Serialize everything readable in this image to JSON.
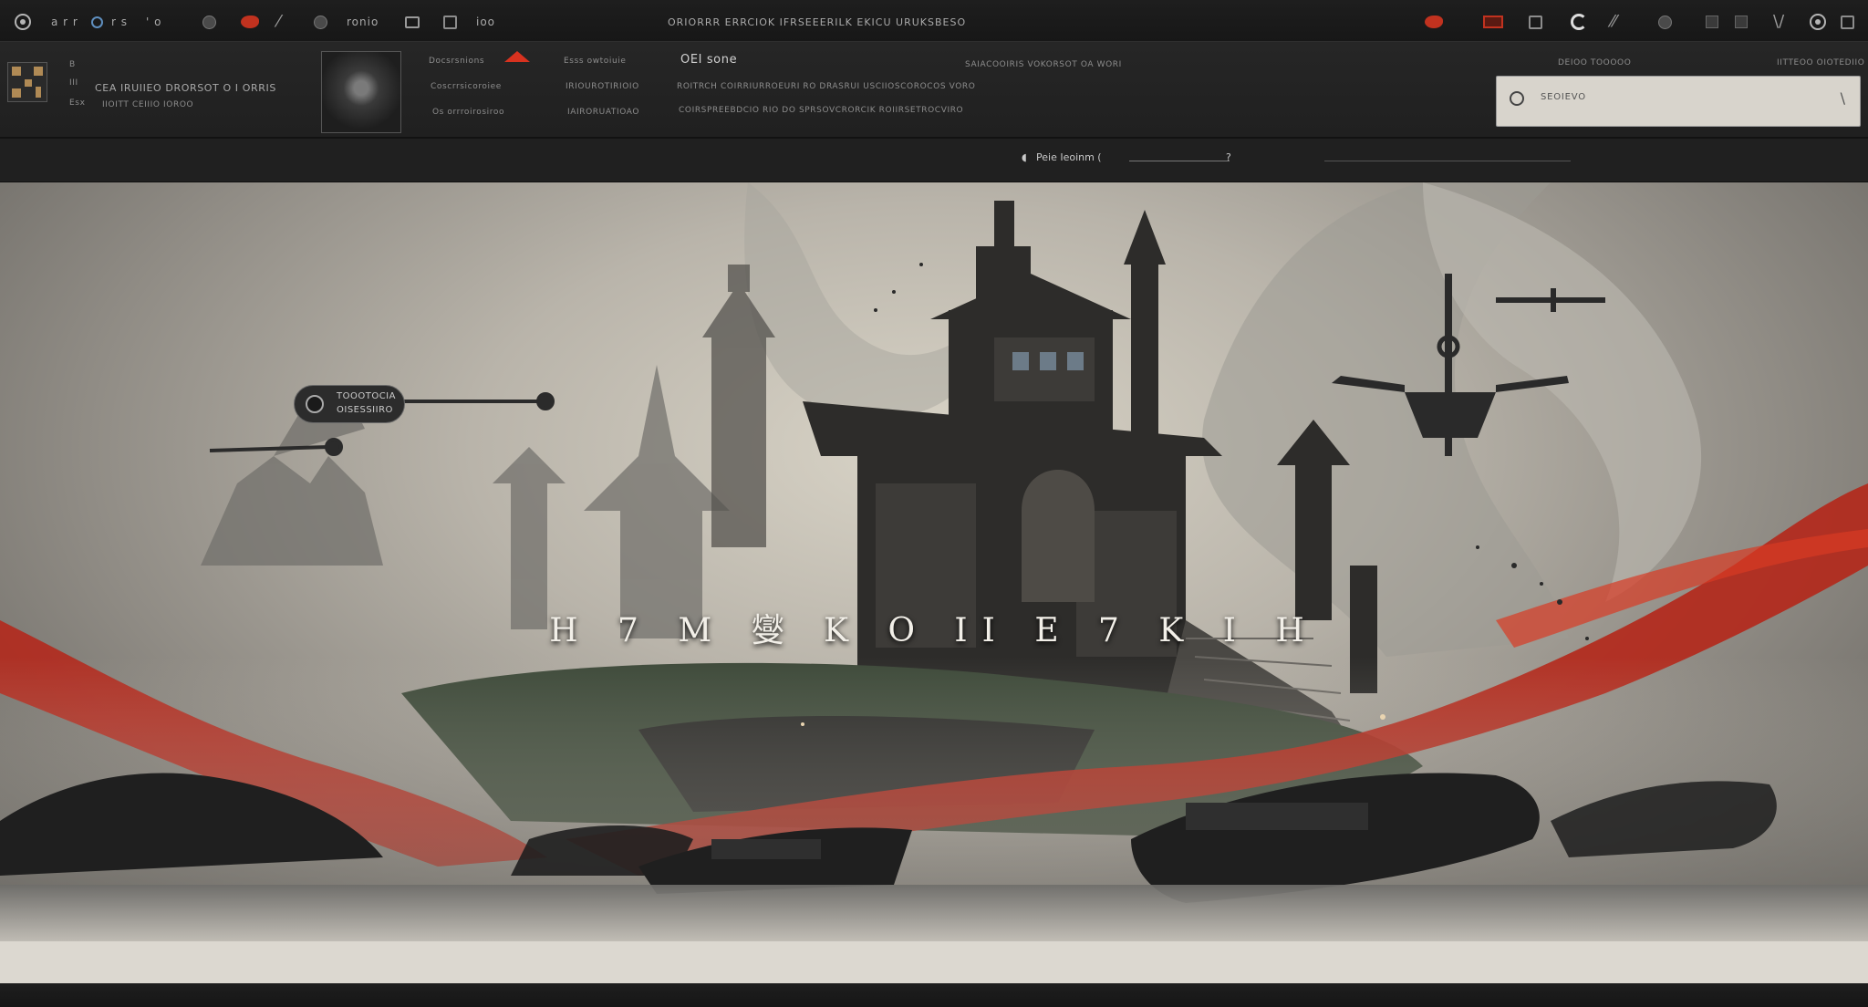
{
  "toolbar": {
    "brand_icon": "logo-circle-icon",
    "item1": "a r r",
    "item2": "r s",
    "item3": "' o",
    "item4": "ronio",
    "item5": "ioo",
    "title": "ORIORRR ERRCIOK IFRSEEERILK EKICU URUKSBESO",
    "accent_color": "#c1321f"
  },
  "props": {
    "left_line1": "CEA IRUIIEO DRORSOT O I ORRIS",
    "left_line2": "IIOITT CEIIIO IOROO",
    "left_tiny1": "B",
    "left_tiny2": "III",
    "left_tiny3": "Esx",
    "col1_row1": "Docsrsnions",
    "col1_row2": "Coscrrsicoroiee",
    "col1_row3": "Os orrroirosiroo",
    "col2_row1": "Esss owtoiuie",
    "col2_row2": "IRIOUROTIRIOIO",
    "col2_row3": "IAIRORUATIOAO",
    "col3_head": "OEI sone",
    "col3_row2": "ROITRCH COIRRIURROEURI RO DRASRUI USCIIOSCOROCOS VORO",
    "col3_row3": "COIRSPREEBDCIO RIO   DO SPRSOVCRORCIK ROIIRSETROCVIRO",
    "right_caption": "SAIACOOIRIS VOKORSOT OA WORI",
    "far_right_a": "DEIOO TOOOOO",
    "far_right_b": "IITTEOO OIOTEDIIO",
    "search_value": "SEOIEVO"
  },
  "ruler": {
    "label": "Peie Ieoinm  ("
  },
  "canvas": {
    "title": "H 7 M 燮 K O II E 7 K I H",
    "pin_line1": "TOOOTOCIA",
    "pin_line2": "OISESSIIRO"
  }
}
